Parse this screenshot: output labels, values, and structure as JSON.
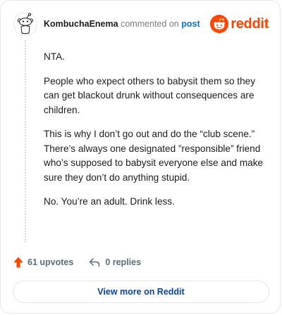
{
  "header": {
    "author": "KombuchaEnema",
    "verb": "commented on",
    "post_link": "post"
  },
  "brand": {
    "wordmark": "reddit",
    "color": "#ff4500",
    "icon": "reddit-snoo-logo"
  },
  "avatar": {
    "icon": "snoo-avatar-outline"
  },
  "comment": {
    "paragraphs": [
      "NTA.",
      "People who expect others to babysit them so they can get blackout drunk without consequences are children.",
      "This is why I don’t go out and do the “club scene.” There’s always one designated ”responsible” friend who’s supposed to babysit everyone else and make sure they don’t do anything stupid.",
      "No. You’re an adult. Drink less."
    ]
  },
  "footer": {
    "upvotes_label": "61 upvotes",
    "upvote_icon": "upvote-arrow-icon",
    "upvote_color": "#ff4500",
    "replies_label": "0 replies",
    "reply_icon": "reply-arrow-icon"
  },
  "cta": {
    "view_more_label": "View more on Reddit",
    "color": "#0a449b"
  }
}
